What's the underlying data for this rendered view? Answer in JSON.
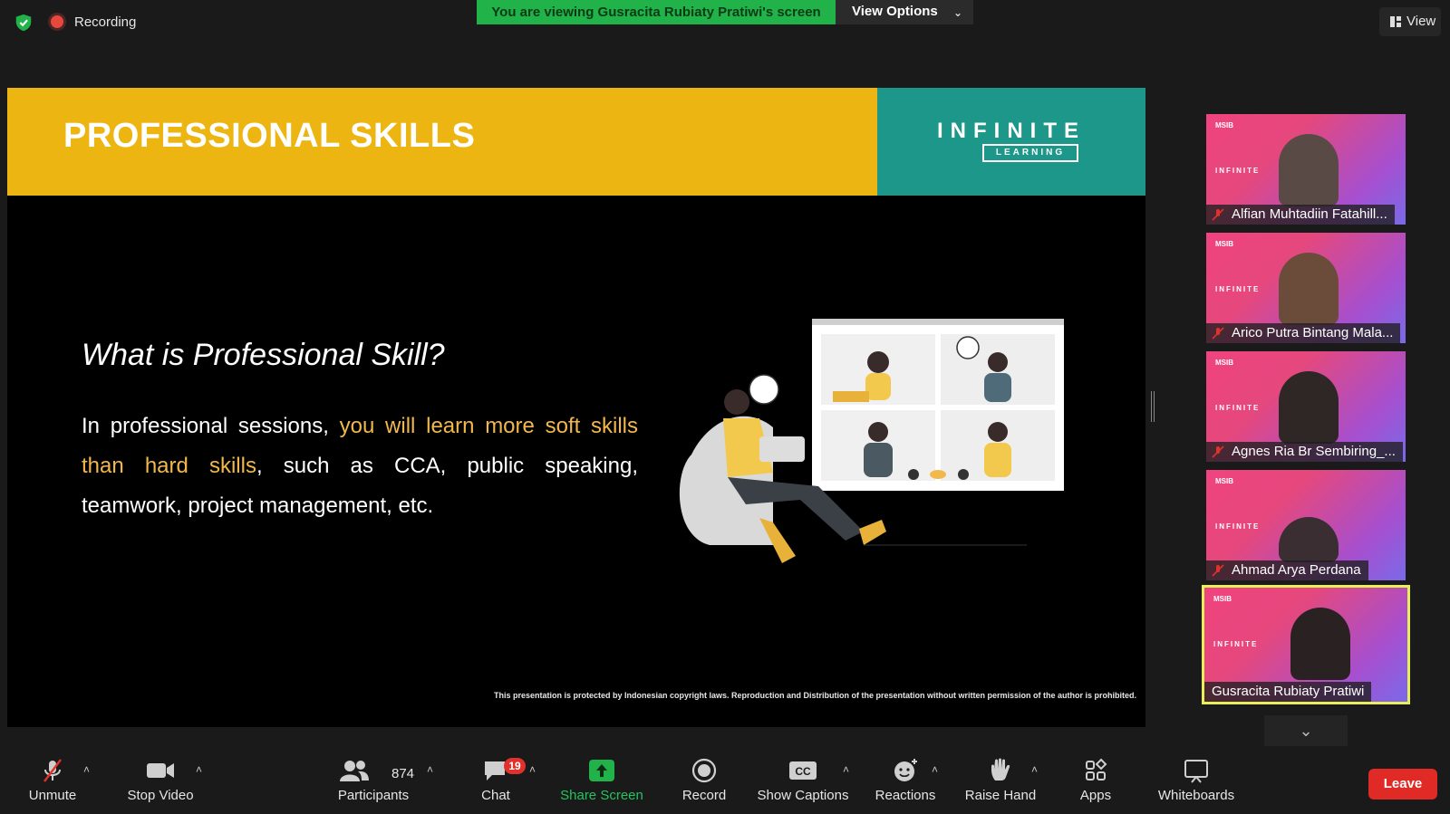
{
  "topbar": {
    "recording_label": "Recording",
    "share_banner": "You are viewing Gusracita Rubiaty Pratiwi's screen",
    "view_options_label": "View Options",
    "view_label": "View"
  },
  "slide": {
    "title": "PROFESSIONAL SKILLS",
    "brand_name": "INFINITE",
    "brand_sub": "LEARNING",
    "question": "What is Professional Skill?",
    "paragraph_start": "In professional sessions, ",
    "paragraph_highlight": "you will learn more soft skills than hard skills",
    "paragraph_end": ", such as CCA, public speaking, teamwork, project management, etc.",
    "copyright": "This presentation is protected  by Indonesian copyright laws. Reproduction and Distribution of the presentation without written permission  of the author is prohibited."
  },
  "participants": [
    {
      "name": "Alfian Muhtadiin Fatahill...",
      "muted": true
    },
    {
      "name": "Arico Putra Bintang Mala...",
      "muted": true
    },
    {
      "name": "Agnes Ria Br Sembiring_...",
      "muted": true
    },
    {
      "name": "Ahmad Arya Perdana",
      "muted": true
    },
    {
      "name": "Gusracita Rubiaty Pratiwi",
      "muted": false,
      "active_speaker": true
    }
  ],
  "toolbar": {
    "unmute": "Unmute",
    "stop_video": "Stop Video",
    "participants": "Participants",
    "participants_count": "874",
    "chat": "Chat",
    "chat_badge": "19",
    "share_screen": "Share Screen",
    "record": "Record",
    "show_captions": "Show Captions",
    "reactions": "Reactions",
    "raise_hand": "Raise Hand",
    "apps": "Apps",
    "whiteboards": "Whiteboards",
    "leave": "Leave"
  },
  "colors": {
    "banner_green": "#21b24a",
    "slide_yellow": "#edb511",
    "brand_teal": "#1c9789",
    "highlight_text": "#f2b84b",
    "leave_red": "#df2a26",
    "active_border": "#e7ef5b"
  }
}
